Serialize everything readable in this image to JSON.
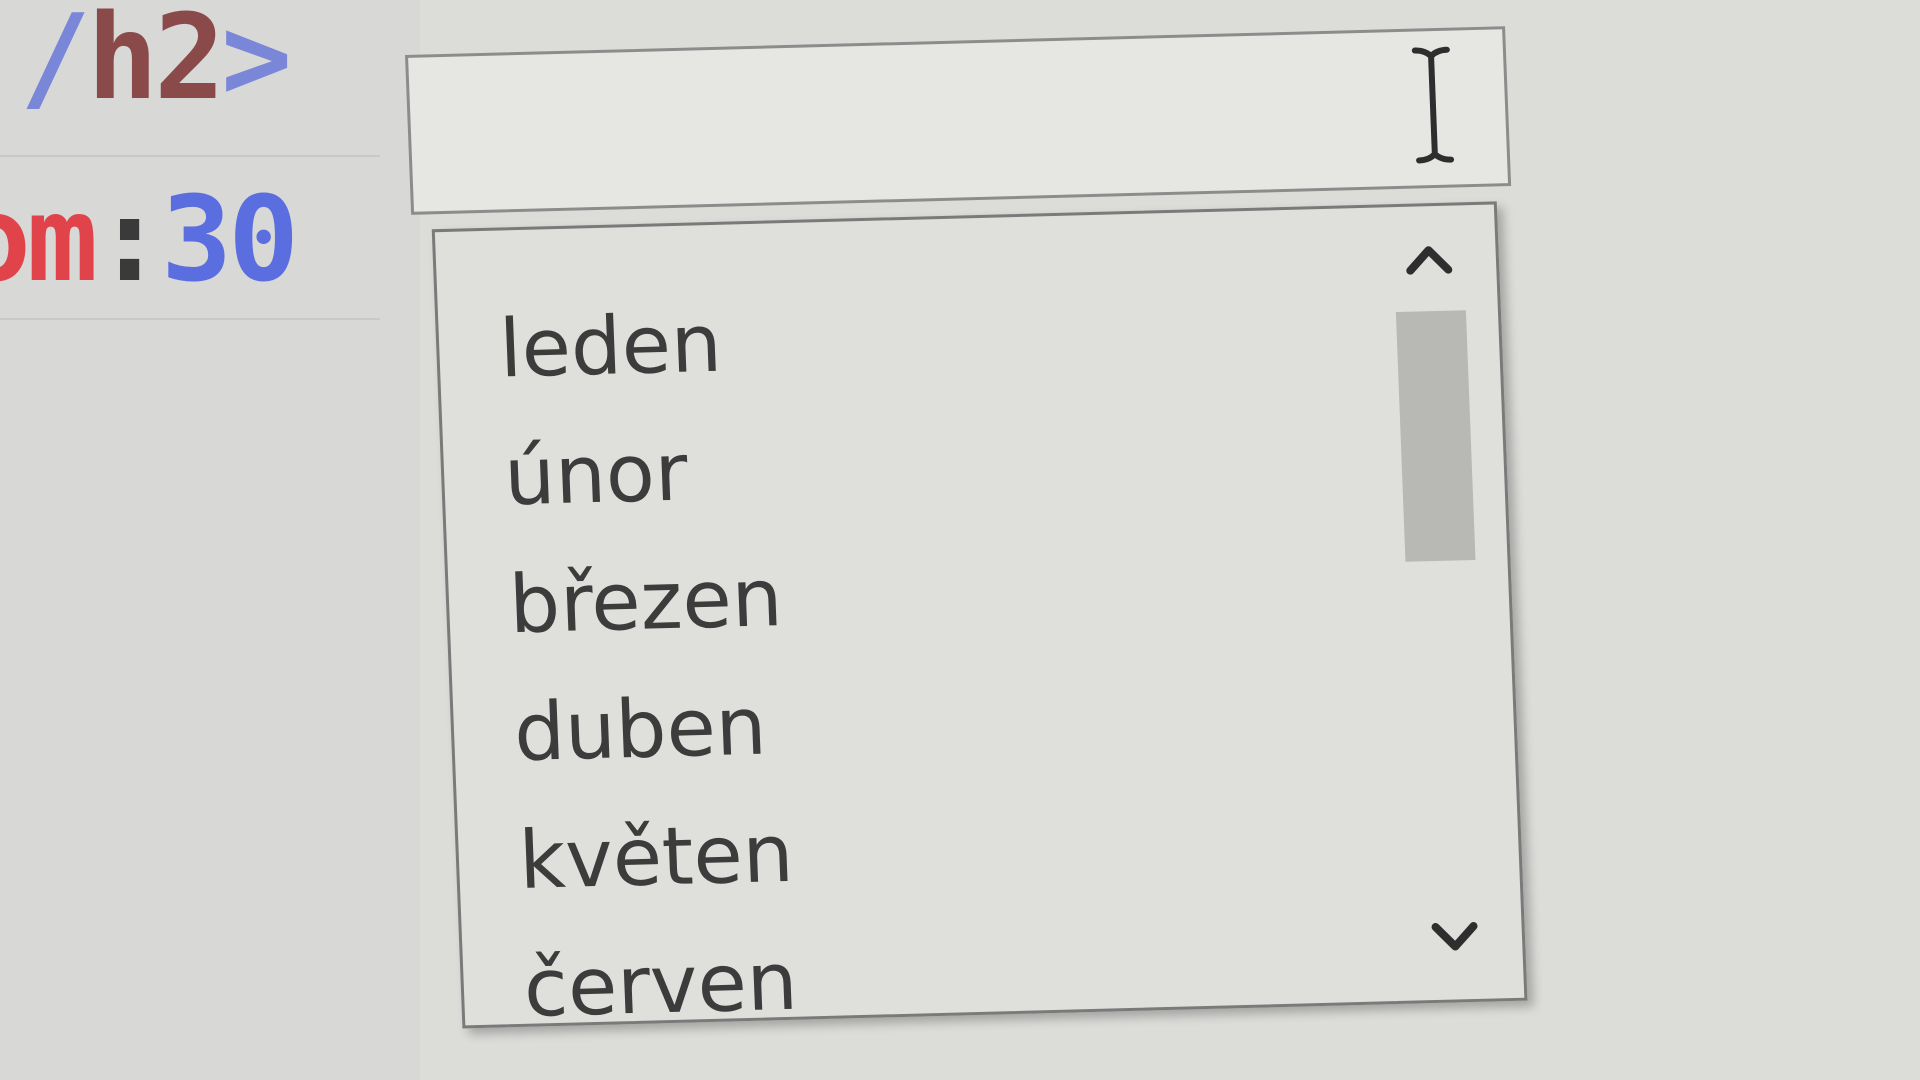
{
  "editor": {
    "line1_slash": "/",
    "line1_tag": "h2",
    "line1_rest": ">",
    "line2_prop": "om",
    "line2_colon": ":",
    "line2_value": "30"
  },
  "combobox": {
    "input_value": "",
    "items": [
      {
        "label": "leden"
      },
      {
        "label": "únor"
      },
      {
        "label": "březen"
      },
      {
        "label": "duben"
      },
      {
        "label": "květen"
      },
      {
        "label": "červen"
      }
    ],
    "icons": {
      "text_cursor": "text-cursor-icon",
      "scroll_up": "chevron-up-icon",
      "scroll_down": "chevron-down-icon"
    }
  },
  "colors": {
    "background": "#dcdcd9",
    "text": "#3c3c3c",
    "code_tag": "#8a4a4a",
    "code_property": "#e0444a",
    "code_value": "#5a6ee0"
  }
}
